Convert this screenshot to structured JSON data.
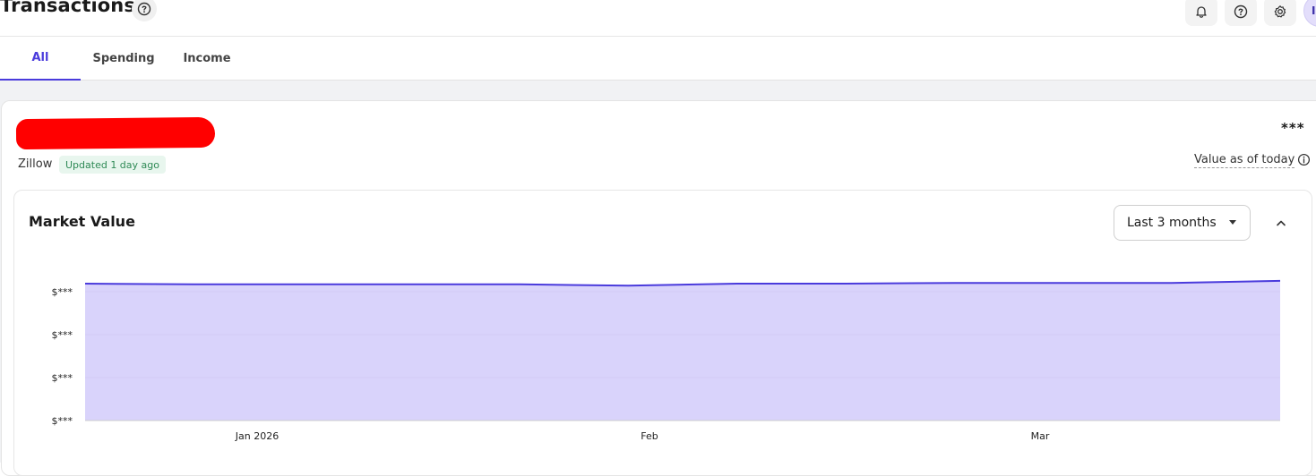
{
  "header": {
    "title": "Transactions",
    "avatar_initial": "I"
  },
  "tabs": [
    {
      "label": "All",
      "active": true
    },
    {
      "label": "Spending",
      "active": false
    },
    {
      "label": "Income",
      "active": false
    }
  ],
  "property": {
    "source": "Zillow",
    "updated_badge": "Updated 1 day ago",
    "value": "***",
    "value_note": "Value as of today"
  },
  "market_value": {
    "title": "Market Value",
    "range_label": "Last 3 months"
  },
  "chart_data": {
    "type": "area",
    "title": "Market Value",
    "x_tick_labels": [
      "Jan 2026",
      "Feb",
      "Mar"
    ],
    "y_tick_labels": [
      "$***",
      "$***",
      "$***",
      "$***"
    ],
    "series": [
      {
        "values": [
          0.99,
          0.985,
          0.985,
          0.985,
          0.985,
          0.975,
          0.99,
          0.99,
          0.995,
          0.995,
          0.995,
          1.01
        ]
      }
    ],
    "ylim": [
      0,
      1.1
    ],
    "grid": true,
    "colors": {
      "line": "#4a3bdc",
      "fill": "#d9d3fb"
    }
  },
  "colors": {
    "accent": "#4a3bdc",
    "badge_bg": "#e8f6ee",
    "badge_text": "#2f8a56",
    "redaction": "#ff0000"
  }
}
